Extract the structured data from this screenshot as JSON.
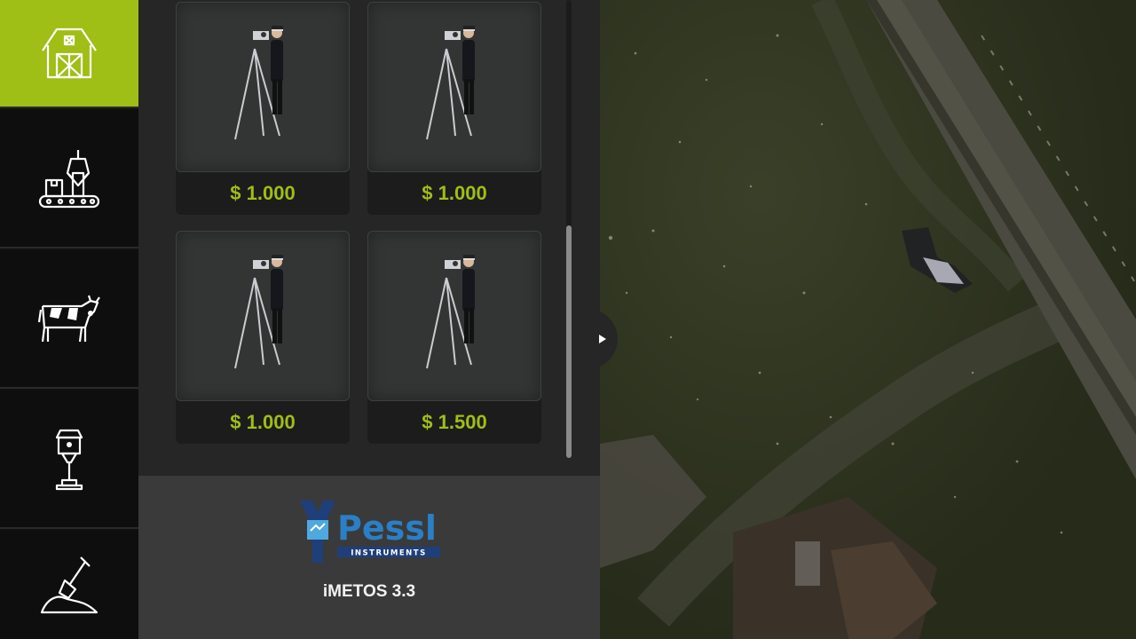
{
  "sidebar": {
    "categories": [
      {
        "icon": "barn-icon",
        "active": true
      },
      {
        "icon": "production-conveyor-icon",
        "active": false
      },
      {
        "icon": "cow-icon",
        "active": false
      },
      {
        "icon": "lantern-icon",
        "active": false
      },
      {
        "icon": "shovel-icon",
        "active": false
      }
    ],
    "accent_color": "#9fbe16"
  },
  "shop": {
    "items": [
      {
        "price": "$ 1.000"
      },
      {
        "price": "$ 1.000"
      },
      {
        "price": "$ 1.000"
      },
      {
        "price": "$ 1.500"
      }
    ],
    "price_color": "#9fbe16"
  },
  "selected_item": {
    "brand_name": "Pessl",
    "brand_sub": "INSTRUMENTS",
    "name": "iMETOS 3.3"
  },
  "icons": {
    "collapse": "triangle-right-icon",
    "active_marker": "triangle-right-icon"
  }
}
